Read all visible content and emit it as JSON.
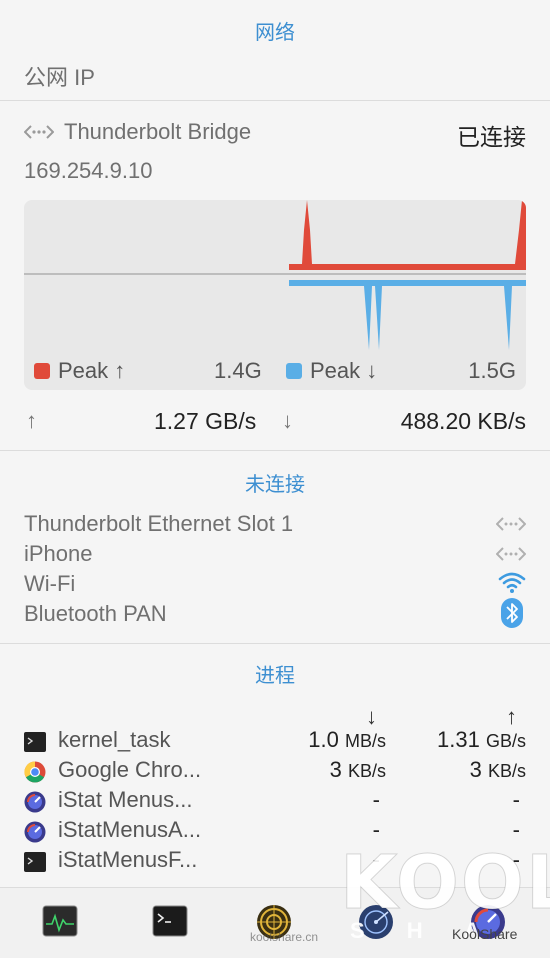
{
  "network": {
    "section_title": "网络",
    "public_ip_label": "公网 IP",
    "connected": {
      "name": "Thunderbolt Bridge",
      "status": "已连接",
      "ip": "169.254.9.10",
      "legend_upload_label": "Peak ↑",
      "legend_upload_value": "1.4G",
      "legend_download_label": "Peak ↓",
      "legend_download_value": "1.5G",
      "upload_arrow": "↑",
      "upload_rate": "1.27 GB/s",
      "download_arrow": "↓",
      "download_rate": "488.20 KB/s"
    },
    "colors": {
      "upload": "#e04a3a",
      "download": "#5aaee6",
      "accent": "#3d8fd1"
    }
  },
  "disconnected": {
    "section_title": "未连接",
    "items": [
      {
        "name": "Thunderbolt Ethernet Slot 1",
        "icon": "ethernet-icon"
      },
      {
        "name": "iPhone",
        "icon": "ethernet-icon"
      },
      {
        "name": "Wi-Fi",
        "icon": "wifi-icon"
      },
      {
        "name": "Bluetooth PAN",
        "icon": "bluetooth-icon"
      }
    ]
  },
  "processes": {
    "section_title": "进程",
    "down_arrow": "↓",
    "up_arrow": "↑",
    "rows": [
      {
        "name": "kernel_task",
        "icon": "terminal-icon",
        "down": "1.0",
        "down_unit": "MB/s",
        "up": "1.31",
        "up_unit": "GB/s"
      },
      {
        "name": "Google Chro...",
        "icon": "chrome-icon",
        "down": "3",
        "down_unit": "KB/s",
        "up": "3",
        "up_unit": "KB/s"
      },
      {
        "name": "iStat Menus...",
        "icon": "istat-icon",
        "down": "-",
        "down_unit": "",
        "up": "-",
        "up_unit": ""
      },
      {
        "name": "iStatMenusA...",
        "icon": "istat-icon",
        "down": "-",
        "down_unit": "",
        "up": "-",
        "up_unit": ""
      },
      {
        "name": "iStatMenusF...",
        "icon": "terminal-icon",
        "down": "-",
        "down_unit": "",
        "up": "-",
        "up_unit": ""
      }
    ]
  },
  "dock": {
    "icons": [
      "activity-monitor-icon",
      "terminal-icon",
      "network-utility-icon",
      "network-radar-icon",
      "istat-icon"
    ]
  },
  "watermark": {
    "text": "KOOL",
    "subtext": "S H A",
    "handle": "KoolShare",
    "site": "koolshare.cn"
  }
}
